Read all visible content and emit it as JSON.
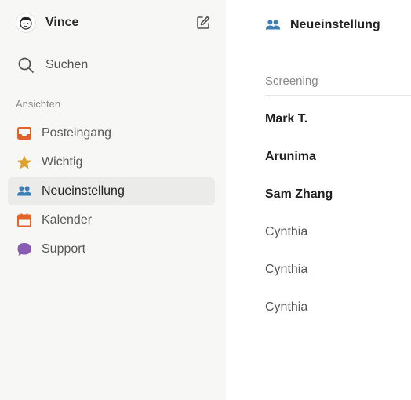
{
  "sidebar": {
    "user": {
      "name": "Vince",
      "avatar_icon": "avatar-face-icon"
    },
    "compose_icon": "compose-icon",
    "search": {
      "label": "Suchen",
      "icon": "search-icon"
    },
    "section_label": "Ansichten",
    "items": [
      {
        "label": "Posteingang",
        "icon": "inbox-icon",
        "color": "#e2622b",
        "active": false
      },
      {
        "label": "Wichtig",
        "icon": "star-icon",
        "color": "#e0a030",
        "active": false
      },
      {
        "label": "Neueinstellung",
        "icon": "people-icon",
        "color": "#3f7fb5",
        "active": true
      },
      {
        "label": "Kalender",
        "icon": "calendar-icon",
        "color": "#e2622b",
        "active": false
      },
      {
        "label": "Support",
        "icon": "chat-bubble-icon",
        "color": "#8a5bb5",
        "active": false
      }
    ]
  },
  "main": {
    "title": "Neueinstellung",
    "title_icon": "people-icon",
    "group_label": "Screening",
    "items": [
      {
        "name": "Mark T.",
        "unread": true
      },
      {
        "name": "Arunima",
        "unread": true
      },
      {
        "name": "Sam Zhang",
        "unread": true
      },
      {
        "name": "Cynthia",
        "unread": false
      },
      {
        "name": "Cynthia",
        "unread": false
      },
      {
        "name": "Cynthia",
        "unread": false
      }
    ]
  }
}
